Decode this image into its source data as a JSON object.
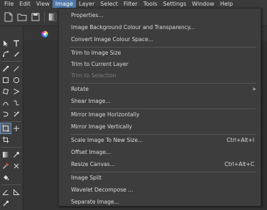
{
  "menubar": {
    "items": [
      "File",
      "Edit",
      "View",
      "Image",
      "Layer",
      "Select",
      "Filter",
      "Tools",
      "Settings",
      "Window",
      "Help"
    ],
    "active": "Image"
  },
  "image_menu": {
    "items": [
      {
        "label": "Properties...",
        "enabled": true
      },
      {
        "label": "Image Background Colour and Transparency...",
        "enabled": true
      },
      {
        "label": "Convert Image Colour Space...",
        "enabled": true
      },
      {
        "label": "Trim to Image Size",
        "enabled": true
      },
      {
        "label": "Trim to Current Layer",
        "enabled": true
      },
      {
        "label": "Trim to Selection",
        "enabled": false
      },
      {
        "label": "Rotate",
        "enabled": true,
        "submenu": true
      },
      {
        "label": "Shear Image...",
        "enabled": true
      },
      {
        "label": "Mirror Image Horizontally",
        "enabled": true
      },
      {
        "label": "Mirror Image Vertically",
        "enabled": true
      },
      {
        "label": "Scale Image To New Size...",
        "enabled": true,
        "shortcut": "Ctrl+Alt+I"
      },
      {
        "label": "Offset Image...",
        "enabled": true
      },
      {
        "label": "Resize Canvas...",
        "enabled": true,
        "shortcut": "Ctrl+Alt+C"
      },
      {
        "label": "Image Split",
        "enabled": true
      },
      {
        "label": "Wavelet Decompose ...",
        "enabled": true
      },
      {
        "label": "Separate Image...",
        "enabled": true
      }
    ]
  },
  "colors": {
    "menu_highlight": "#4f78a8",
    "menu_bg": "#3d3d3d",
    "disabled_text": "#7d7d7d"
  }
}
